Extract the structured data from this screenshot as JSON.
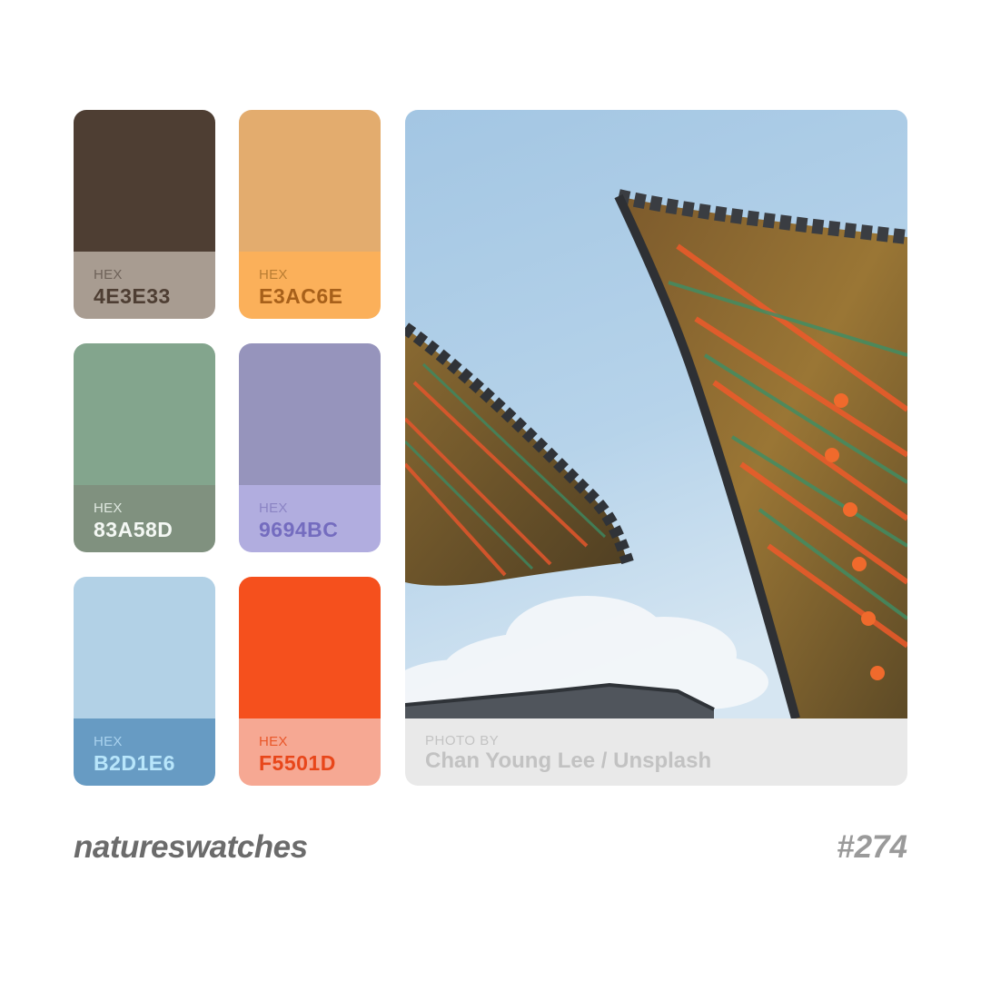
{
  "swatches": [
    {
      "label": "HEX",
      "value": "4E3E33",
      "color": "#4e3e33",
      "info_bg": "#a89c91",
      "label_color": "#6e6259",
      "value_color": "#4e3e33"
    },
    {
      "label": "HEX",
      "value": "E3AC6E",
      "color": "#e3ac6e",
      "info_bg": "#fbb05a",
      "label_color": "#b97d33",
      "value_color": "#a7601a"
    },
    {
      "label": "HEX",
      "value": "83A58D",
      "color": "#83a58d",
      "info_bg": "#80917f",
      "label_color": "#dfe8e0",
      "value_color": "#f4f8f4"
    },
    {
      "label": "HEX",
      "value": "9694BC",
      "color": "#9694bc",
      "info_bg": "#b1addf",
      "label_color": "#8b84c4",
      "value_color": "#746cbf"
    },
    {
      "label": "HEX",
      "value": "B2D1E6",
      "color": "#b2d1e6",
      "info_bg": "#679bc3",
      "label_color": "#a9d2ee",
      "value_color": "#b8e6fb"
    },
    {
      "label": "HEX",
      "value": "F5501D",
      "color": "#f5501d",
      "info_bg": "#f6a893",
      "label_color": "#e9572a",
      "value_color": "#e8461a"
    }
  ],
  "photo": {
    "credit_label": "PHOTO BY",
    "credit_name": "Chan Young Lee / Unsplash"
  },
  "footer": {
    "brand": "natureswatches",
    "number": "#274"
  }
}
